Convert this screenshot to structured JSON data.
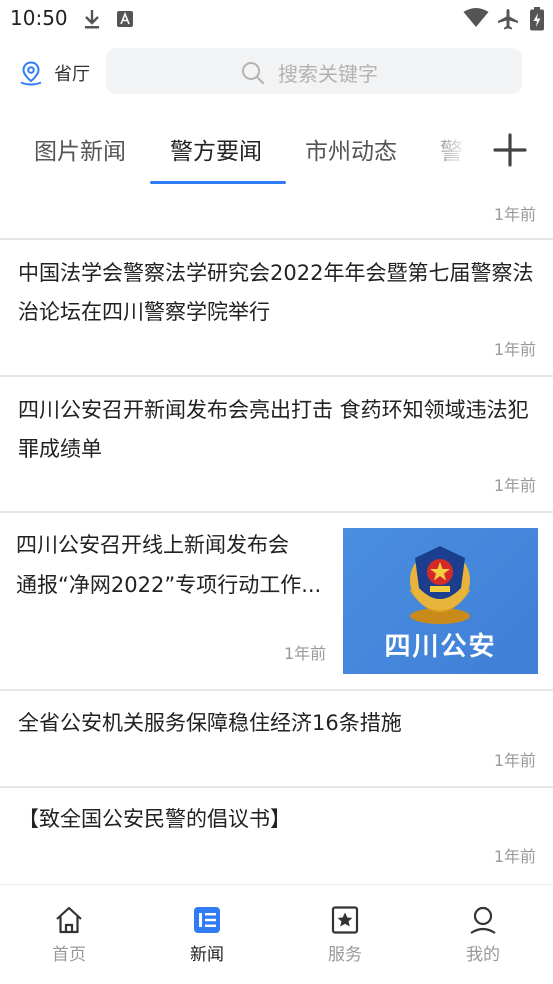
{
  "status_bar": {
    "time": "10:50"
  },
  "header": {
    "location_label": "省厅",
    "search_placeholder": "搜索关键字"
  },
  "tabs": [
    {
      "label": "图片新闻",
      "active": false
    },
    {
      "label": "警方要闻",
      "active": true
    },
    {
      "label": "市州动态",
      "active": false
    },
    {
      "label": "警",
      "active": false
    }
  ],
  "colors": {
    "accent": "#2f7cf6",
    "divider": "#e6e6e6",
    "muted": "#9a9a9a"
  },
  "news": {
    "top_time": "1年前",
    "items": [
      {
        "title": "中国法学会警察法学研究会2022年年会暨第七届警察法治论坛在四川警察学院举行",
        "time": "1年前"
      },
      {
        "title": "四川公安召开新闻发布会亮出打击 食药环知领域违法犯罪成绩单",
        "time": "1年前"
      },
      {
        "title_line1": "四川公安召开线上新闻发布会",
        "title_line2": "通报“净网2022”专项行动工作...",
        "time": "1年前",
        "image_text": "四川公安"
      },
      {
        "title": "全省公安机关服务保障稳住经济16条措施",
        "time": "1年前"
      },
      {
        "title": "【致全国公安民警的倡议书】",
        "time": "1年前"
      }
    ]
  },
  "bottom_nav": [
    {
      "label": "首页",
      "icon": "home-icon",
      "active": false
    },
    {
      "label": "新闻",
      "icon": "news-icon",
      "active": true
    },
    {
      "label": "服务",
      "icon": "service-star-icon",
      "active": false
    },
    {
      "label": "我的",
      "icon": "profile-icon",
      "active": false
    }
  ]
}
